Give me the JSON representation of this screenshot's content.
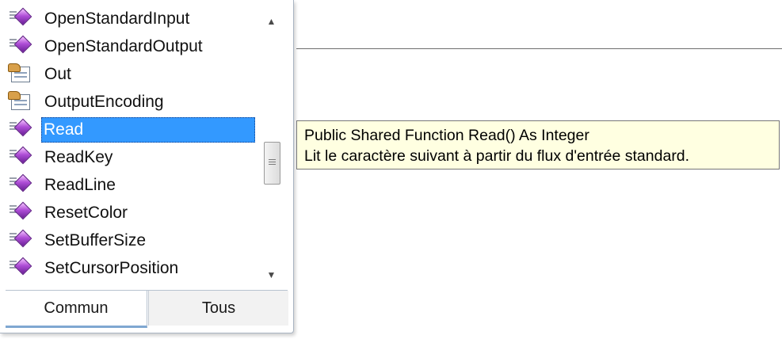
{
  "completion_list": {
    "items": [
      {
        "label": "OpenStandardInput",
        "icon": "method-icon",
        "selected": false
      },
      {
        "label": "OpenStandardOutput",
        "icon": "method-icon",
        "selected": false
      },
      {
        "label": "Out",
        "icon": "property-icon",
        "selected": false
      },
      {
        "label": "OutputEncoding",
        "icon": "property-icon",
        "selected": false
      },
      {
        "label": "Read",
        "icon": "method-icon",
        "selected": true
      },
      {
        "label": "ReadKey",
        "icon": "method-icon",
        "selected": false
      },
      {
        "label": "ReadLine",
        "icon": "method-icon",
        "selected": false
      },
      {
        "label": "ResetColor",
        "icon": "method-icon",
        "selected": false
      },
      {
        "label": "SetBufferSize",
        "icon": "method-icon",
        "selected": false
      },
      {
        "label": "SetCursorPosition",
        "icon": "method-icon",
        "selected": false
      }
    ],
    "tabs": [
      {
        "label": "Commun",
        "active": true
      },
      {
        "label": "Tous",
        "active": false
      }
    ],
    "selection_color": "#3399ff"
  },
  "tooltip": {
    "signature": "Public Shared Function Read() As Integer",
    "description": "Lit le caractère suivant à partir du flux d'entrée standard.",
    "background": "#ffffe1"
  }
}
